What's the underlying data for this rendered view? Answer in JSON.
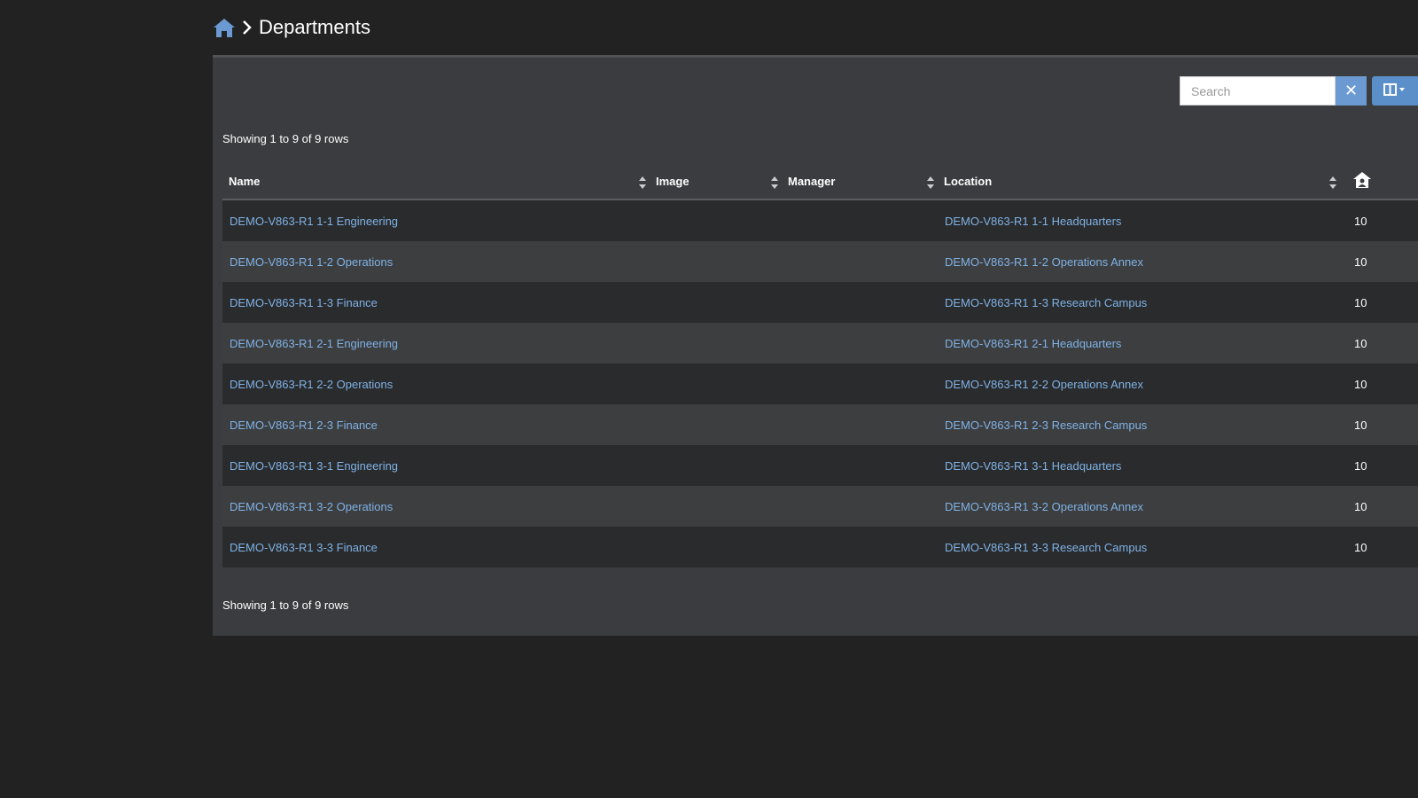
{
  "breadcrumb": {
    "home_icon": "home-icon",
    "separator_icon": "chevron-right-icon",
    "title": "Departments"
  },
  "toolbar": {
    "search_placeholder": "Search",
    "search_value": "",
    "clear_label": "✕",
    "columns_icon": "columns-icon"
  },
  "table": {
    "rows_info": "Showing 1 to 9 of 9 rows",
    "headers": {
      "name": "Name",
      "image": "Image",
      "manager": "Manager",
      "location": "Location",
      "count_icon": "house-user-icon"
    },
    "rows": [
      {
        "name": "DEMO-V863-R1 1-1 Engineering",
        "image": "",
        "manager": "",
        "location": "DEMO-V863-R1 1-1 Headquarters",
        "count": "10"
      },
      {
        "name": "DEMO-V863-R1 1-2 Operations",
        "image": "",
        "manager": "",
        "location": "DEMO-V863-R1 1-2 Operations Annex",
        "count": "10"
      },
      {
        "name": "DEMO-V863-R1 1-3 Finance",
        "image": "",
        "manager": "",
        "location": "DEMO-V863-R1 1-3 Research Campus",
        "count": "10"
      },
      {
        "name": "DEMO-V863-R1 2-1 Engineering",
        "image": "",
        "manager": "",
        "location": "DEMO-V863-R1 2-1 Headquarters",
        "count": "10"
      },
      {
        "name": "DEMO-V863-R1 2-2 Operations",
        "image": "",
        "manager": "",
        "location": "DEMO-V863-R1 2-2 Operations Annex",
        "count": "10"
      },
      {
        "name": "DEMO-V863-R1 2-3 Finance",
        "image": "",
        "manager": "",
        "location": "DEMO-V863-R1 2-3 Research Campus",
        "count": "10"
      },
      {
        "name": "DEMO-V863-R1 3-1 Engineering",
        "image": "",
        "manager": "",
        "location": "DEMO-V863-R1 3-1 Headquarters",
        "count": "10"
      },
      {
        "name": "DEMO-V863-R1 3-2 Operations",
        "image": "",
        "manager": "",
        "location": "DEMO-V863-R1 3-2 Operations Annex",
        "count": "10"
      },
      {
        "name": "DEMO-V863-R1 3-3 Finance",
        "image": "",
        "manager": "",
        "location": "DEMO-V863-R1 3-3 Research Campus",
        "count": "10"
      }
    ]
  },
  "colors": {
    "background": "#222222",
    "panel": "#3a3c3f",
    "link": "#7fb2e5",
    "accent": "#5b8fc9"
  }
}
